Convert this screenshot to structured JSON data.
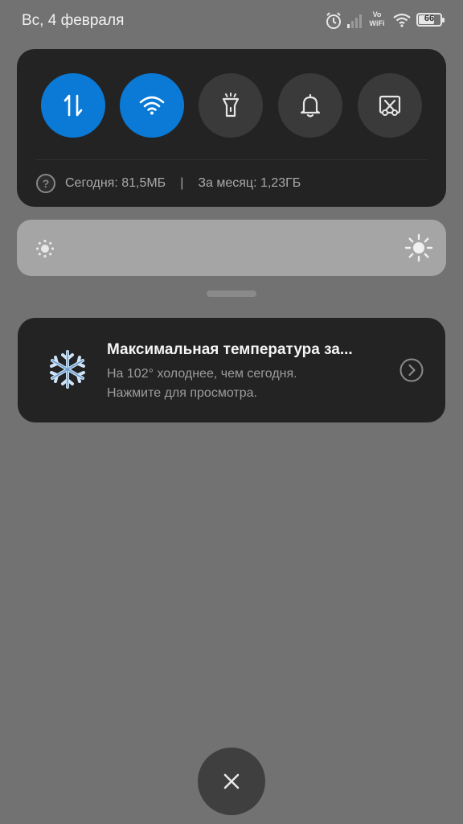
{
  "status_bar": {
    "date": "Вс, 4 февраля",
    "volte": "Vo",
    "wifi_text": "WiFi",
    "battery": "66",
    "icons": [
      "alarm-icon",
      "signal-icon",
      "vowifi-icon",
      "wifi-icon",
      "battery-icon"
    ]
  },
  "quick_settings": {
    "tiles": [
      {
        "icon": "mobile-data-icon",
        "active": true
      },
      {
        "icon": "wifi-icon",
        "active": true
      },
      {
        "icon": "flashlight-icon",
        "active": false
      },
      {
        "icon": "bell-icon",
        "active": false
      },
      {
        "icon": "screenshot-icon",
        "active": false
      }
    ],
    "data_usage": {
      "today": "Сегодня: 81,5МБ",
      "separator": "|",
      "month": "За месяц: 1,23ГБ"
    }
  },
  "notification": {
    "icon": "snowflake-icon",
    "title": "Максимальная температура за...",
    "line1": "На 102° холоднее, чем сегодня.",
    "line2": "Нажмите для просмотра."
  },
  "colors": {
    "accent": "#0a7ad6",
    "background": "#727272",
    "panel": "#232323"
  }
}
